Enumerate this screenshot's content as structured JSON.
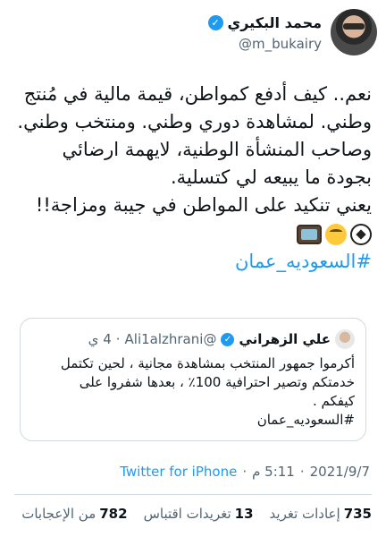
{
  "author": {
    "name": "محمد البكيري",
    "handle": "@m_bukairy",
    "verified_icon": "verified-badge-icon"
  },
  "tweet": {
    "lines": [
      "نعم.. كيف أدفع كمواطن، قيمة مالية في مُنتج",
      "وطني. لمشاهدة دوري وطني. ومنتخب وطني.",
      "وصاحب المنشأة الوطنية، لايهمة ارضائي",
      "بجودة ما يبيعه لي كتسلية.",
      "يعني تنكيد على المواطن في جيبة ومزاجة!!"
    ],
    "emojis": [
      "soccer-ball-icon",
      "monocle-face-icon",
      "television-icon"
    ],
    "hashtag": "#السعوديه_عمان"
  },
  "quoted_tweet": {
    "name": "علي الزهراني",
    "handle": "@Ali1alzhrani",
    "time": "4 ي",
    "lines": [
      "أكرموا جمهور المنتخب بمشاهدة مجانية ، لحين تكتمل",
      "خدمتكم وتصير احترافية 100٪ ، بعدها شفروا على",
      "كيفكم .",
      "#السعوديه_عمان"
    ]
  },
  "meta": {
    "date": "2021/9/7",
    "time": "5:11 م",
    "source": "Twitter for iPhone"
  },
  "stats": {
    "retweets_count": "735",
    "retweets_label": "إعادات تغريد",
    "quotes_count": "13",
    "quotes_label": "تغريدات اقتباس",
    "likes_count": "782",
    "likes_label": "من الإعجابات"
  },
  "colors": {
    "accent": "#1d9bf0",
    "muted": "#536471",
    "border": "#cfd9de"
  }
}
